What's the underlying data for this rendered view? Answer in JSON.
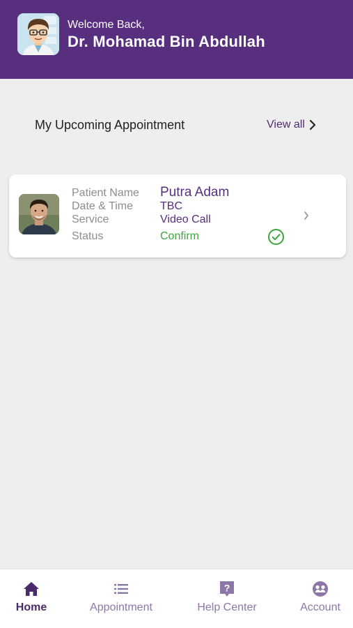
{
  "header": {
    "welcome": "Welcome Back,",
    "doctor_name": "Dr. Mohamad Bin Abdullah"
  },
  "upcoming": {
    "title": "My Upcoming Appointment",
    "view_all": "View all"
  },
  "appointment": {
    "labels": {
      "patient_name": "Patient Name",
      "date_time": "Date & Time",
      "service": "Service",
      "status": "Status"
    },
    "values": {
      "patient_name": "Putra Adam",
      "date_time": "TBC",
      "service": "Video Call",
      "status": "Confirm"
    },
    "status_icon": "check-circle-icon"
  },
  "nav": {
    "items": [
      {
        "label": "Home",
        "icon": "home-icon",
        "active": true
      },
      {
        "label": "Appointment",
        "icon": "list-icon",
        "active": false
      },
      {
        "label": "Help Center",
        "icon": "help-icon",
        "active": false
      },
      {
        "label": "Account",
        "icon": "account-icon",
        "active": false
      }
    ]
  },
  "colors": {
    "primary": "#582e7f",
    "status_confirm": "#3aa53a",
    "background": "#efeeef"
  }
}
